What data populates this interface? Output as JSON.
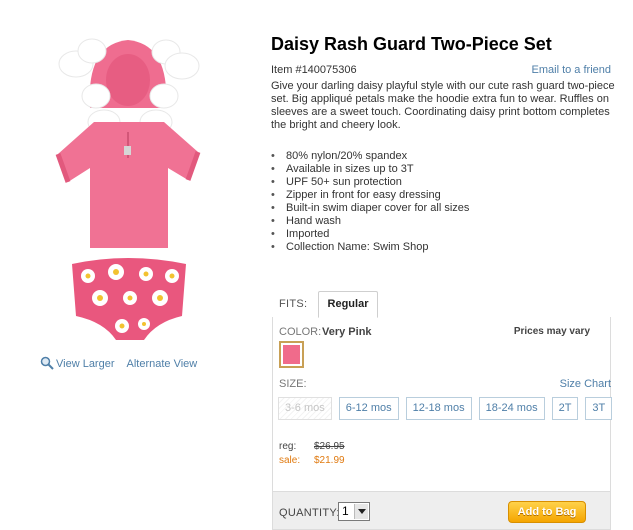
{
  "product": {
    "title": "Daisy Rash Guard Two-Piece Set",
    "item_number": "Item #140075306",
    "email_link": "Email to a friend",
    "description": "Give your darling daisy playful style with our cute rash guard two-piece set. Big appliqué petals make the hoodie extra fun to wear. Ruffles on sleeves are a sweet touch. Coordinating daisy print bottom completes the bright and cheery look.",
    "features": [
      "80% nylon/20% spandex",
      "Available in sizes up to 3T",
      "UPF 50+ sun protection",
      "Zipper in front for easy dressing",
      "Built-in swim diaper cover for all sizes",
      "Hand wash",
      "Imported",
      "Collection Name: Swim Shop"
    ]
  },
  "image_links": {
    "view_larger": "View Larger",
    "alternate_view": "Alternate View"
  },
  "fits": {
    "label": "FITS:",
    "tabs": [
      "Regular"
    ]
  },
  "color": {
    "label": "COLOR:",
    "value": "Very Pink",
    "swatch_color": "#f06b8b",
    "prices_note": "Prices may vary"
  },
  "size": {
    "label": "SIZE:",
    "chart_link": "Size Chart",
    "options": [
      {
        "label": "3-6 mos",
        "available": false
      },
      {
        "label": "6-12 mos",
        "available": true
      },
      {
        "label": "12-18 mos",
        "available": true
      },
      {
        "label": "18-24 mos",
        "available": true
      },
      {
        "label": "2T",
        "available": true
      },
      {
        "label": "3T",
        "available": true
      }
    ]
  },
  "price": {
    "reg_label": "reg:",
    "reg_value": "$26.95",
    "sale_label": "sale:",
    "sale_value": "$21.99"
  },
  "quantity": {
    "label": "QUANTITY:",
    "value": "1"
  },
  "add_to_bag": "Add to Bag",
  "colors": {
    "link": "#4f7fa8",
    "sale": "#e07a10",
    "button": "#f5a500"
  }
}
